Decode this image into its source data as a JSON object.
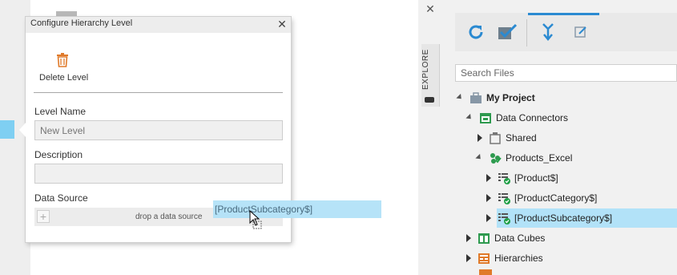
{
  "dialog": {
    "title": "Configure Hierarchy Level",
    "delete_label": "Delete Level",
    "level_name_label": "Level Name",
    "level_name_placeholder": "New Level",
    "description_label": "Description",
    "description_value": "",
    "data_source_label": "Data Source",
    "drop_hint": "drop a data source"
  },
  "drag": {
    "text": "[ProductSubcategory$]"
  },
  "side_panel": {
    "tab_label": "EXPLORE",
    "search_placeholder": "Search Files",
    "tree": [
      {
        "label": "My Project",
        "bold": true,
        "expanded": true,
        "icon": "briefcase-icon"
      },
      {
        "label": "Data Connectors",
        "expanded": true,
        "icon": "data-connectors-icon"
      },
      {
        "label": "Shared",
        "expanded": false,
        "icon": "shared-folder-icon"
      },
      {
        "label": "Products_Excel",
        "expanded": true,
        "icon": "excel-connector-icon"
      },
      {
        "label": "[Product$]",
        "expanded": false,
        "icon": "table-check-icon"
      },
      {
        "label": "[ProductCategory$]",
        "expanded": false,
        "icon": "table-check-icon"
      },
      {
        "label": "[ProductSubcategory$]",
        "expanded": false,
        "icon": "table-check-icon",
        "selected": true
      },
      {
        "label": "Data Cubes",
        "expanded": false,
        "icon": "cube-icon"
      },
      {
        "label": "Hierarchies",
        "expanded": false,
        "icon": "hierarchy-icon"
      }
    ]
  },
  "colors": {
    "accent": "#2b8ad1",
    "selection": "#b2e2f8",
    "delete_icon": "#e07a2a",
    "check_green": "#1f9e45"
  }
}
